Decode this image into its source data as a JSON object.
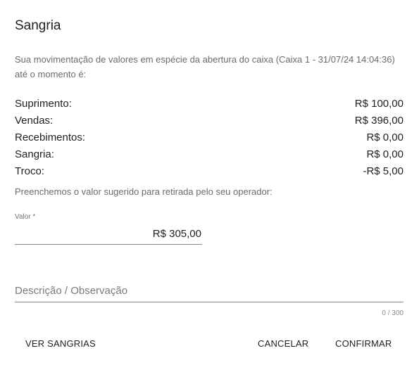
{
  "dialog": {
    "title": "Sangria",
    "intro": "Sua movimentação de valores em espécie da abertura do caixa (Caixa 1 - 31/07/24 14:04:36) até o momento é:",
    "summary": [
      {
        "label": "Suprimento:",
        "value": "R$ 100,00"
      },
      {
        "label": "Vendas:",
        "value": "R$ 396,00"
      },
      {
        "label": "Recebimentos:",
        "value": "R$ 0,00"
      },
      {
        "label": "Sangria:",
        "value": "R$ 0,00"
      },
      {
        "label": "Troco:",
        "value": "-R$ 5,00"
      }
    ],
    "hint": "Preenchemos o valor sugerido para retirada pelo seu operador:",
    "valor_field": {
      "label": "Valor *",
      "value": "R$ 305,00"
    },
    "description_field": {
      "placeholder": "Descrição / Observação",
      "value": "",
      "counter": "0 / 300"
    },
    "actions": {
      "ver_sangrias": "VER SANGRIAS",
      "cancelar": "CANCELAR",
      "confirmar": "CONFIRMAR"
    }
  }
}
